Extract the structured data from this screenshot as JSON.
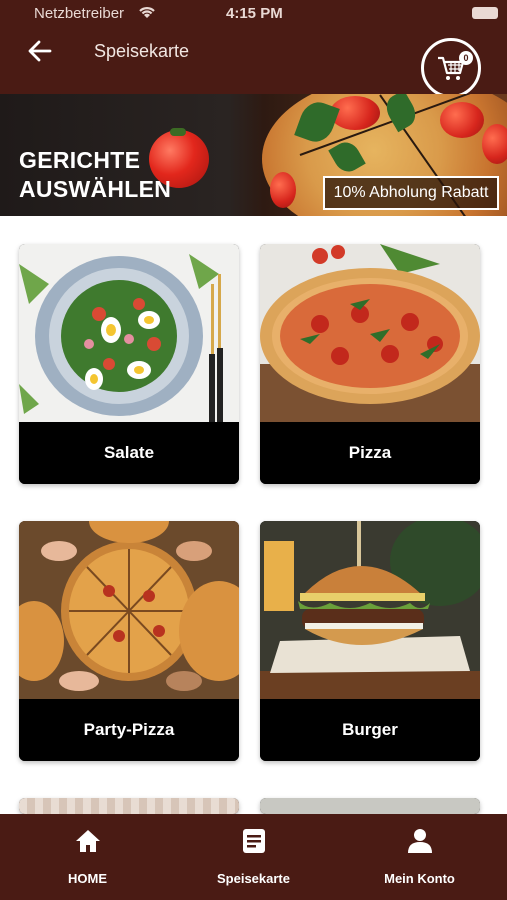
{
  "status_bar": {
    "carrier": "Netzbetreiber",
    "time": "4:15 PM"
  },
  "header": {
    "title": "Speisekarte",
    "cart_count": "0"
  },
  "banner": {
    "headline_line1": "GERICHTE",
    "headline_line2": "AUSWÄHLEN",
    "promo": "10% Abholung Rabatt"
  },
  "categories": [
    {
      "label": "Salate",
      "image": "salad-bowl"
    },
    {
      "label": "Pizza",
      "image": "pizza"
    },
    {
      "label": "Party-Pizza",
      "image": "party-pizza"
    },
    {
      "label": "Burger",
      "image": "burger"
    }
  ],
  "bottom_nav": [
    {
      "label": "HOME",
      "icon": "home-icon"
    },
    {
      "label": "Speisekarte",
      "icon": "menu-book-icon"
    },
    {
      "label": "Mein Konto",
      "icon": "account-icon"
    }
  ],
  "colors": {
    "brand": "#4a1b14",
    "label_bg": "#000000",
    "text_on_brand": "#ffffff"
  }
}
